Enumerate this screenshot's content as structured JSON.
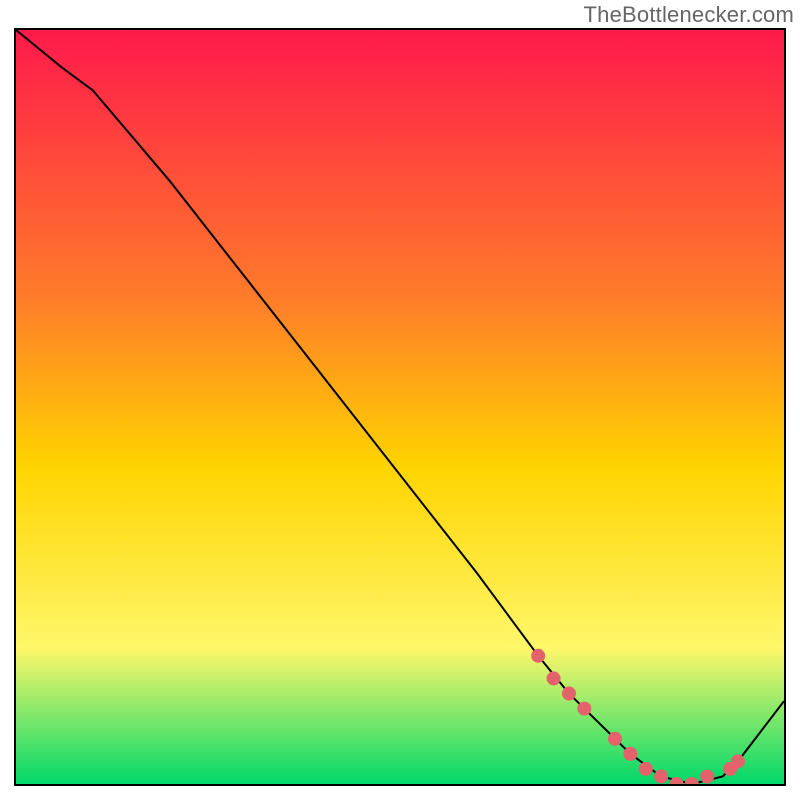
{
  "watermark": "TheBottlenecker.com",
  "colors": {
    "gradient_top": "#ff1a4b",
    "gradient_mid1": "#ff7a2a",
    "gradient_mid2": "#ffd400",
    "gradient_mid3": "#fff76a",
    "gradient_bottom": "#00d86a",
    "curve": "#000000",
    "marker": "#e4626c"
  },
  "chart_data": {
    "type": "line",
    "title": "",
    "xlabel": "",
    "ylabel": "",
    "xlim": [
      0,
      100
    ],
    "ylim": [
      0,
      100
    ],
    "series": [
      {
        "name": "curve",
        "x": [
          0,
          6,
          10,
          20,
          30,
          40,
          50,
          60,
          68,
          72,
          76,
          80,
          84,
          88,
          92,
          94,
          100
        ],
        "y": [
          100,
          95,
          92,
          80,
          67,
          54,
          41,
          28,
          17,
          12,
          8,
          4,
          1,
          0,
          1,
          3,
          11
        ]
      }
    ],
    "markers": {
      "name": "highlight-points",
      "x": [
        68,
        70,
        72,
        74,
        78,
        80,
        82,
        84,
        86,
        88,
        90,
        93,
        94
      ],
      "y": [
        17,
        14,
        12,
        10,
        6,
        4,
        2,
        1,
        0,
        0,
        1,
        2,
        3
      ]
    }
  }
}
